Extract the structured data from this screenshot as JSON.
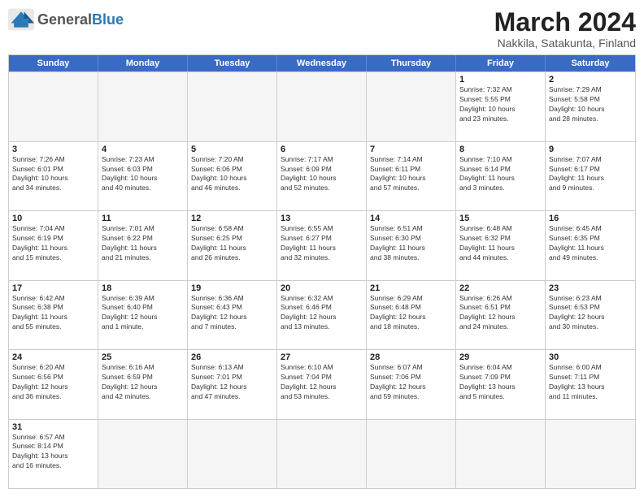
{
  "header": {
    "logo_general": "General",
    "logo_blue": "Blue",
    "month": "March 2024",
    "location": "Nakkila, Satakunta, Finland"
  },
  "days": [
    "Sunday",
    "Monday",
    "Tuesday",
    "Wednesday",
    "Thursday",
    "Friday",
    "Saturday"
  ],
  "rows": [
    [
      {
        "num": "",
        "info": "",
        "empty": true
      },
      {
        "num": "",
        "info": "",
        "empty": true
      },
      {
        "num": "",
        "info": "",
        "empty": true
      },
      {
        "num": "",
        "info": "",
        "empty": true
      },
      {
        "num": "",
        "info": "",
        "empty": true
      },
      {
        "num": "1",
        "info": "Sunrise: 7:32 AM\nSunset: 5:55 PM\nDaylight: 10 hours\nand 23 minutes.",
        "empty": false
      },
      {
        "num": "2",
        "info": "Sunrise: 7:29 AM\nSunset: 5:58 PM\nDaylight: 10 hours\nand 28 minutes.",
        "empty": false
      }
    ],
    [
      {
        "num": "3",
        "info": "Sunrise: 7:26 AM\nSunset: 6:01 PM\nDaylight: 10 hours\nand 34 minutes.",
        "empty": false
      },
      {
        "num": "4",
        "info": "Sunrise: 7:23 AM\nSunset: 6:03 PM\nDaylight: 10 hours\nand 40 minutes.",
        "empty": false
      },
      {
        "num": "5",
        "info": "Sunrise: 7:20 AM\nSunset: 6:06 PM\nDaylight: 10 hours\nand 46 minutes.",
        "empty": false
      },
      {
        "num": "6",
        "info": "Sunrise: 7:17 AM\nSunset: 6:09 PM\nDaylight: 10 hours\nand 52 minutes.",
        "empty": false
      },
      {
        "num": "7",
        "info": "Sunrise: 7:14 AM\nSunset: 6:11 PM\nDaylight: 10 hours\nand 57 minutes.",
        "empty": false
      },
      {
        "num": "8",
        "info": "Sunrise: 7:10 AM\nSunset: 6:14 PM\nDaylight: 11 hours\nand 3 minutes.",
        "empty": false
      },
      {
        "num": "9",
        "info": "Sunrise: 7:07 AM\nSunset: 6:17 PM\nDaylight: 11 hours\nand 9 minutes.",
        "empty": false
      }
    ],
    [
      {
        "num": "10",
        "info": "Sunrise: 7:04 AM\nSunset: 6:19 PM\nDaylight: 11 hours\nand 15 minutes.",
        "empty": false
      },
      {
        "num": "11",
        "info": "Sunrise: 7:01 AM\nSunset: 6:22 PM\nDaylight: 11 hours\nand 21 minutes.",
        "empty": false
      },
      {
        "num": "12",
        "info": "Sunrise: 6:58 AM\nSunset: 6:25 PM\nDaylight: 11 hours\nand 26 minutes.",
        "empty": false
      },
      {
        "num": "13",
        "info": "Sunrise: 6:55 AM\nSunset: 6:27 PM\nDaylight: 11 hours\nand 32 minutes.",
        "empty": false
      },
      {
        "num": "14",
        "info": "Sunrise: 6:51 AM\nSunset: 6:30 PM\nDaylight: 11 hours\nand 38 minutes.",
        "empty": false
      },
      {
        "num": "15",
        "info": "Sunrise: 6:48 AM\nSunset: 6:32 PM\nDaylight: 11 hours\nand 44 minutes.",
        "empty": false
      },
      {
        "num": "16",
        "info": "Sunrise: 6:45 AM\nSunset: 6:35 PM\nDaylight: 11 hours\nand 49 minutes.",
        "empty": false
      }
    ],
    [
      {
        "num": "17",
        "info": "Sunrise: 6:42 AM\nSunset: 6:38 PM\nDaylight: 11 hours\nand 55 minutes.",
        "empty": false
      },
      {
        "num": "18",
        "info": "Sunrise: 6:39 AM\nSunset: 6:40 PM\nDaylight: 12 hours\nand 1 minute.",
        "empty": false
      },
      {
        "num": "19",
        "info": "Sunrise: 6:36 AM\nSunset: 6:43 PM\nDaylight: 12 hours\nand 7 minutes.",
        "empty": false
      },
      {
        "num": "20",
        "info": "Sunrise: 6:32 AM\nSunset: 6:46 PM\nDaylight: 12 hours\nand 13 minutes.",
        "empty": false
      },
      {
        "num": "21",
        "info": "Sunrise: 6:29 AM\nSunset: 6:48 PM\nDaylight: 12 hours\nand 18 minutes.",
        "empty": false
      },
      {
        "num": "22",
        "info": "Sunrise: 6:26 AM\nSunset: 6:51 PM\nDaylight: 12 hours\nand 24 minutes.",
        "empty": false
      },
      {
        "num": "23",
        "info": "Sunrise: 6:23 AM\nSunset: 6:53 PM\nDaylight: 12 hours\nand 30 minutes.",
        "empty": false
      }
    ],
    [
      {
        "num": "24",
        "info": "Sunrise: 6:20 AM\nSunset: 6:56 PM\nDaylight: 12 hours\nand 36 minutes.",
        "empty": false
      },
      {
        "num": "25",
        "info": "Sunrise: 6:16 AM\nSunset: 6:59 PM\nDaylight: 12 hours\nand 42 minutes.",
        "empty": false
      },
      {
        "num": "26",
        "info": "Sunrise: 6:13 AM\nSunset: 7:01 PM\nDaylight: 12 hours\nand 47 minutes.",
        "empty": false
      },
      {
        "num": "27",
        "info": "Sunrise: 6:10 AM\nSunset: 7:04 PM\nDaylight: 12 hours\nand 53 minutes.",
        "empty": false
      },
      {
        "num": "28",
        "info": "Sunrise: 6:07 AM\nSunset: 7:06 PM\nDaylight: 12 hours\nand 59 minutes.",
        "empty": false
      },
      {
        "num": "29",
        "info": "Sunrise: 6:04 AM\nSunset: 7:09 PM\nDaylight: 13 hours\nand 5 minutes.",
        "empty": false
      },
      {
        "num": "30",
        "info": "Sunrise: 6:00 AM\nSunset: 7:11 PM\nDaylight: 13 hours\nand 11 minutes.",
        "empty": false
      }
    ],
    [
      {
        "num": "31",
        "info": "Sunrise: 6:57 AM\nSunset: 8:14 PM\nDaylight: 13 hours\nand 16 minutes.",
        "empty": false
      },
      {
        "num": "",
        "info": "",
        "empty": true
      },
      {
        "num": "",
        "info": "",
        "empty": true
      },
      {
        "num": "",
        "info": "",
        "empty": true
      },
      {
        "num": "",
        "info": "",
        "empty": true
      },
      {
        "num": "",
        "info": "",
        "empty": true
      },
      {
        "num": "",
        "info": "",
        "empty": true
      }
    ]
  ]
}
